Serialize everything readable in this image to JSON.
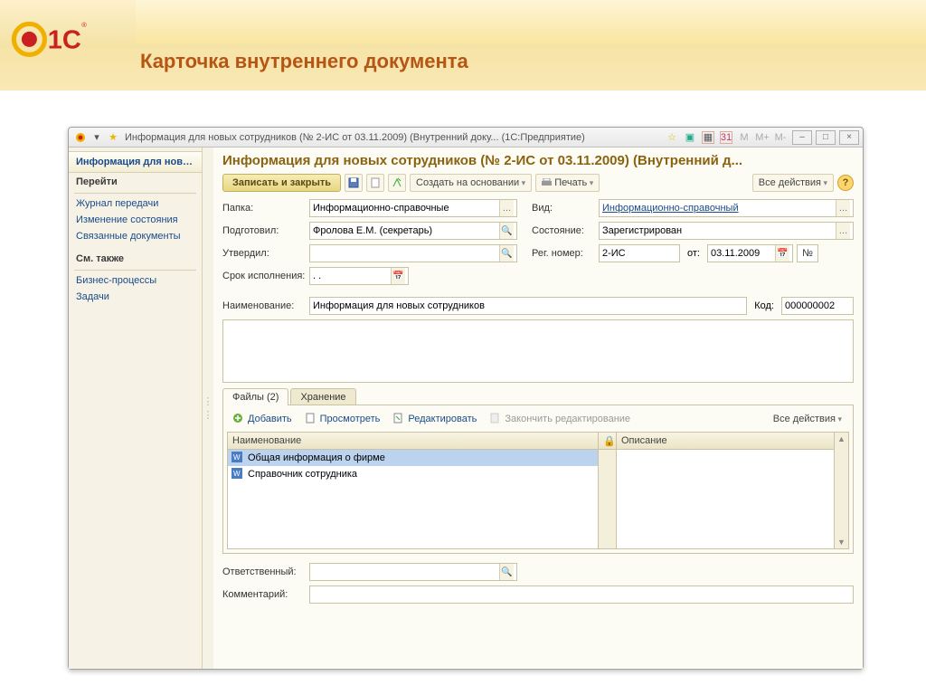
{
  "slide": {
    "title": "Карточка внутреннего документа",
    "logo": "1C"
  },
  "window": {
    "title": "Информация для новых сотрудников (№ 2-ИС от 03.11.2009) (Внутренний доку... (1С:Предприятие)",
    "m_buttons": [
      "M",
      "M+",
      "M-"
    ]
  },
  "nav": {
    "tab_active": "Информация для нов…",
    "group1_title": "Перейти",
    "group1_items": [
      "Журнал передачи",
      "Изменение состояния",
      "Связанные документы"
    ],
    "group2_title": "См. также",
    "group2_items": [
      "Бизнес-процессы",
      "Задачи"
    ]
  },
  "doc": {
    "title": "Информация для новых сотрудников (№ 2-ИС от 03.11.2009) (Внутренний д...",
    "save_close": "Записать и закрыть",
    "create_based": "Создать на основании",
    "print": "Печать",
    "all_actions": "Все действия",
    "labels": {
      "folder": "Папка:",
      "prepared": "Подготовил:",
      "approved": "Утвердил:",
      "deadline": "Срок исполнения:",
      "name": "Наименование:",
      "kind": "Вид:",
      "status": "Состояние:",
      "regnum": "Рег. номер:",
      "from": "от:",
      "num": "№",
      "code": "Код:",
      "responsible": "Ответственный:",
      "comment": "Комментарий:"
    },
    "values": {
      "folder": "Информационно-справочные",
      "prepared": "Фролова Е.М. (секретарь)",
      "approved": "",
      "deadline": ". .",
      "name": "Информация для новых сотрудников",
      "kind": "Информационно-справочный",
      "status": "Зарегистрирован",
      "regnum": "2-ИС",
      "from_date": "03.11.2009",
      "code": "000000002",
      "responsible": "",
      "comment": ""
    }
  },
  "tabs": {
    "files": "Файлы (2)",
    "storage": "Хранение",
    "sub": {
      "add": "Добавить",
      "view": "Просмотреть",
      "edit": "Редактировать",
      "finish": "Закончить редактирование",
      "all": "Все действия"
    },
    "headers": {
      "name": "Наименование",
      "desc": "Описание"
    },
    "rows": [
      "Общая информация о фирме",
      "Справочник сотрудника"
    ]
  }
}
